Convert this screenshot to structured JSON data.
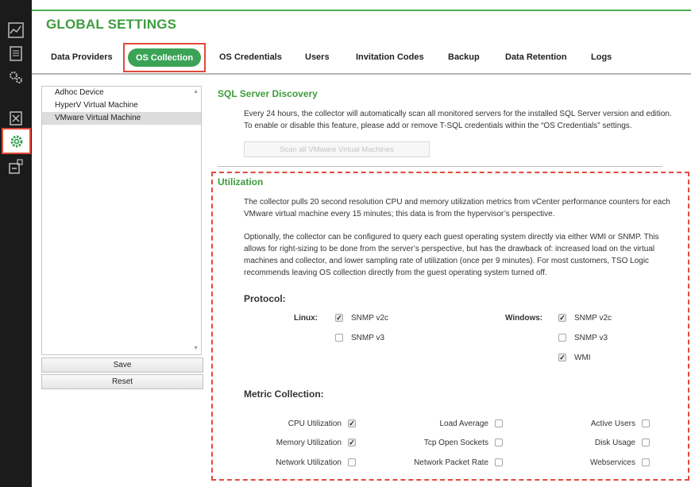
{
  "title": "GLOBAL SETTINGS",
  "tabs": [
    {
      "label": "Data Providers"
    },
    {
      "label": "OS Collection"
    },
    {
      "label": "OS Credentials"
    },
    {
      "label": "Users"
    },
    {
      "label": "Invitation Codes"
    },
    {
      "label": "Backup"
    },
    {
      "label": "Data Retention"
    },
    {
      "label": "Logs"
    }
  ],
  "rail_icons": [
    "chart-icon",
    "clipboard-icon",
    "gears-icon",
    "checklist-icon",
    "settings-gear-icon",
    "export-icon"
  ],
  "device_list": {
    "items": [
      "Adhoc Device",
      "HyperV Virtual Machine",
      "VMware Virtual Machine"
    ],
    "selected": "VMware Virtual Machine",
    "save_label": "Save",
    "reset_label": "Reset"
  },
  "sql": {
    "heading": "SQL Server Discovery",
    "line1": "Every 24 hours, the collector will automatically scan all monitored servers for the installed SQL Server version and edition.",
    "line2": "To enable or disable this feature, please add or remove T-SQL credentials within the “OS Credentials” settings.",
    "scan_label": "Scan all VMware Virtual Machines"
  },
  "utilization": {
    "heading": "Utilization",
    "p1_l1": "The collector pulls 20 second resolution CPU and memory utilization metrics from vCenter performance counters for each",
    "p1_l2": "VMware virtual machine every 15 minutes; this data is from the hypervisor’s perspective.",
    "p2_l1": "Optionally, the collector can be configured to query each guest operating system directly via either WMI or SNMP. This",
    "p2_l2": "allows for right-sizing to be done from the server’s perspective, but has the drawback of: increased load on the virtual",
    "p2_l3": "machines and collector, and lower sampling rate of utilization (once per 9 minutes). For most customers, TSO Logic",
    "p2_l4": "recommends leaving OS collection directly from the guest operating system turned off."
  },
  "protocol": {
    "heading": "Protocol:",
    "linux_label": "Linux:",
    "windows_label": "Windows:",
    "linux_options": [
      {
        "label": "SNMP v2c",
        "checked": true
      },
      {
        "label": "SNMP v3",
        "checked": false
      }
    ],
    "windows_options": [
      {
        "label": "SNMP v2c",
        "checked": true
      },
      {
        "label": "SNMP v3",
        "checked": false
      },
      {
        "label": "WMI",
        "checked": true
      }
    ]
  },
  "metrics": {
    "heading": "Metric Collection:",
    "items": [
      {
        "label": "CPU Utilization",
        "checked": true
      },
      {
        "label": "Memory Utilization",
        "checked": true
      },
      {
        "label": "Network Utilization",
        "checked": false
      },
      {
        "label": "Load Average",
        "checked": false
      },
      {
        "label": "Tcp Open Sockets",
        "checked": false
      },
      {
        "label": "Network Packet Rate",
        "checked": false
      },
      {
        "label": "Active Users",
        "checked": false
      },
      {
        "label": "Disk Usage",
        "checked": false
      },
      {
        "label": "Webservices",
        "checked": false
      }
    ]
  },
  "colors": {
    "accent": "#3aa356",
    "highlight": "#e24a3b",
    "rail": "#1b1b1b"
  }
}
